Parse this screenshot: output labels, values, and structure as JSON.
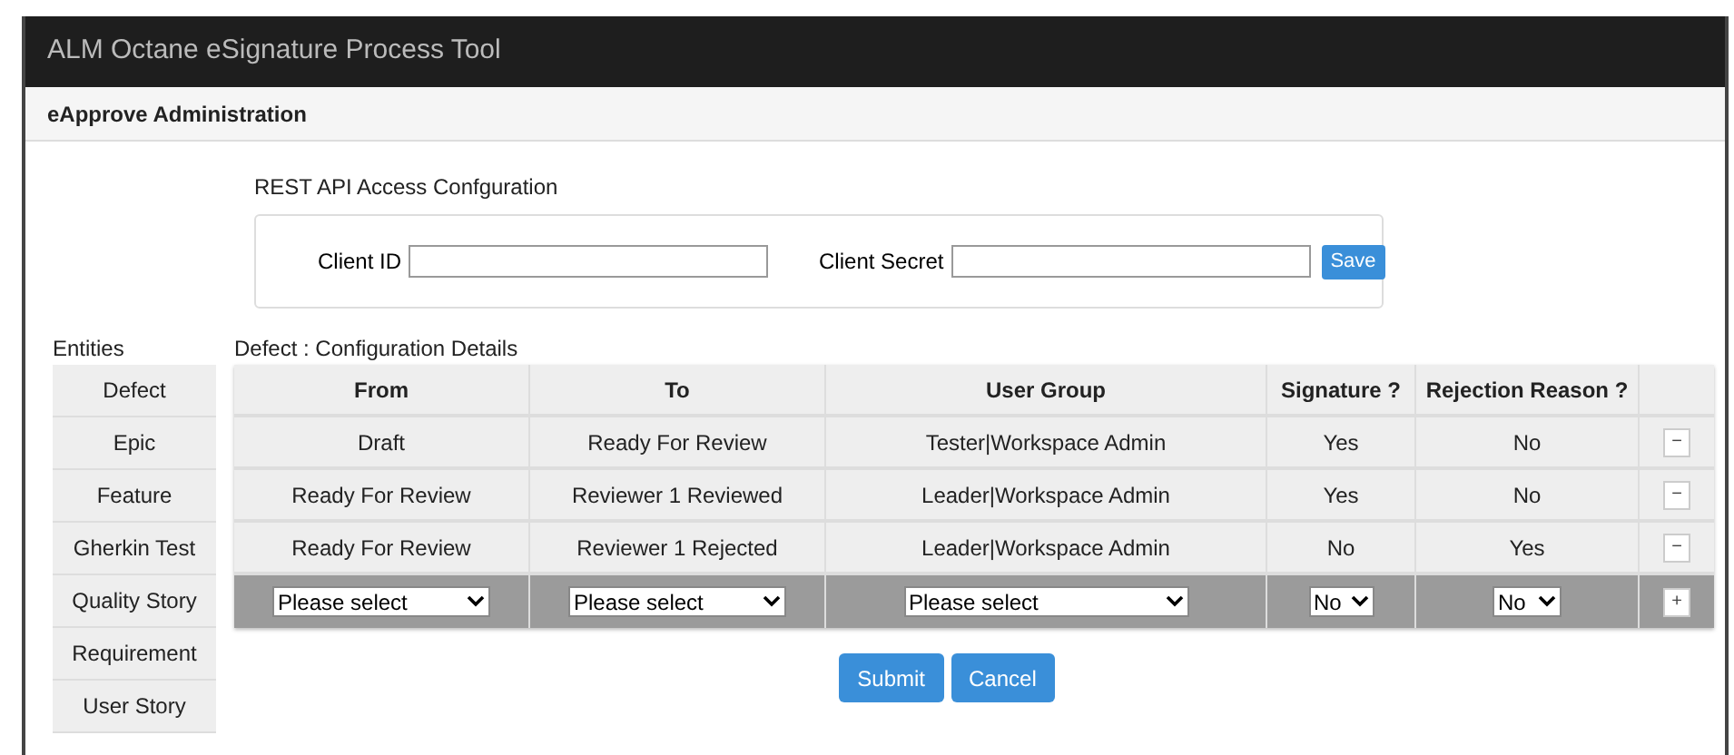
{
  "window": {
    "title": "ALM Octane eSignature Process Tool"
  },
  "page_header": "eApprove Administration",
  "rest_api": {
    "title": "REST API Access Confguration",
    "client_id_label": "Client ID",
    "client_secret_label": "Client Secret",
    "save_button": "Save"
  },
  "entities": {
    "title": "Entities",
    "items": [
      "Defect",
      "Epic",
      "Feature",
      "Gherkin Test",
      "Quality Story",
      "Requirement",
      "User Story"
    ]
  },
  "table": {
    "title": "Defect : Configuration Details",
    "columns": [
      "From",
      "To",
      "User Group",
      "Signature ?",
      "Rejection Reason ?"
    ],
    "rows": [
      {
        "from": "Draft",
        "to": "Ready For Review",
        "user_group": "Tester|Workspace Admin",
        "signature": "Yes",
        "rejection_reason": "No",
        "action": "−"
      },
      {
        "from": "Ready For Review",
        "to": "Reviewer 1 Reviewed",
        "user_group": "Leader|Workspace Admin",
        "signature": "Yes",
        "rejection_reason": "No",
        "action": "−"
      },
      {
        "from": "Ready For Review",
        "to": "Reviewer 1 Rejected",
        "user_group": "Leader|Workspace Admin",
        "signature": "No",
        "rejection_reason": "Yes",
        "action": "−"
      }
    ],
    "new_row": {
      "from": "Please select",
      "to": "Please select",
      "user_group": "Please select",
      "signature": "No",
      "rejection_reason": "No",
      "action": "+"
    }
  },
  "buttons": [
    "Submit",
    "Cancel"
  ]
}
